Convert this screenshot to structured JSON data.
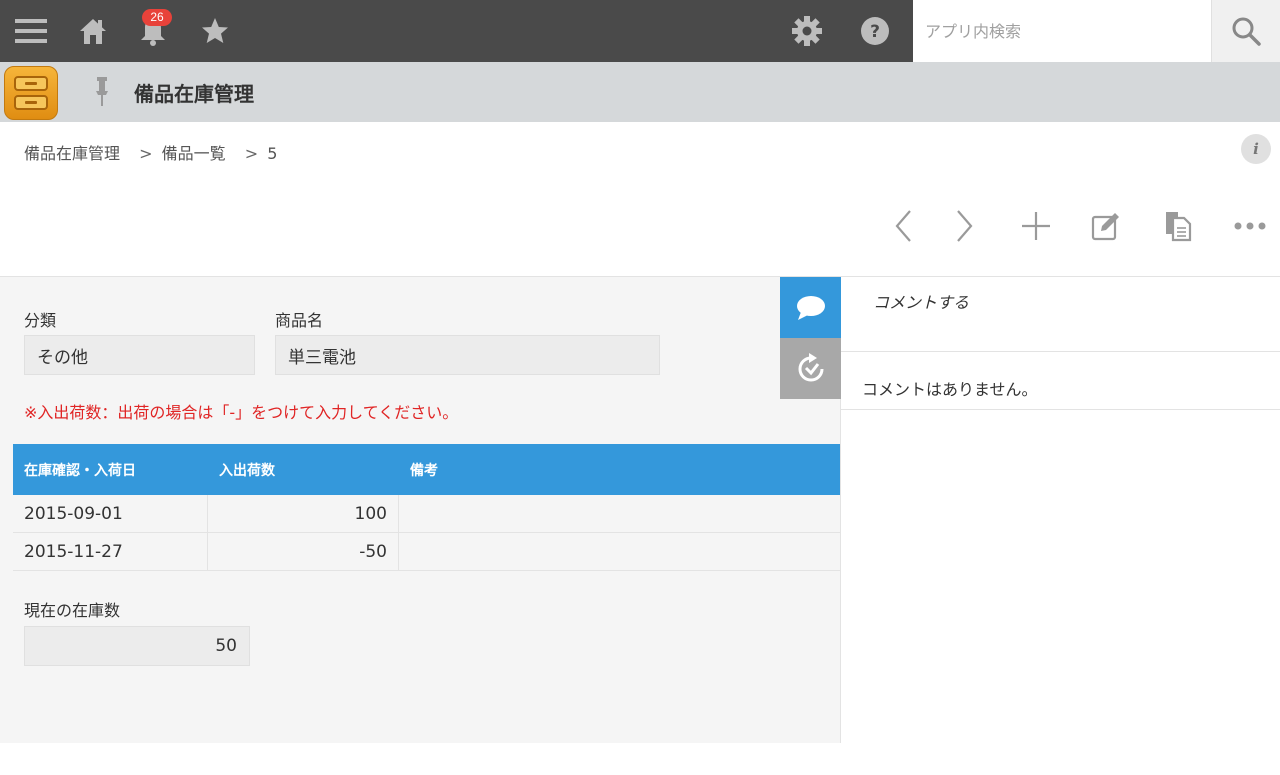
{
  "topbar": {
    "notification_count": "26",
    "search_placeholder": "アプリ内検索"
  },
  "app": {
    "title": "備品在庫管理"
  },
  "breadcrumb": {
    "items": [
      "備品在庫管理",
      "備品一覧",
      "5"
    ],
    "separator": ">"
  },
  "toolbar": {
    "icons": [
      "chevron-left-icon",
      "chevron-right-icon",
      "plus-icon",
      "edit-icon",
      "copy-icon",
      "more-icon"
    ]
  },
  "record": {
    "category_label": "分類",
    "category_value": "その他",
    "product_label": "商品名",
    "product_value": "単三電池",
    "notice": "※入出荷数：出荷の場合は「-」をつけて入力してください。",
    "table": {
      "headers": [
        "在庫確認・入荷日",
        "入出荷数",
        "備考"
      ],
      "rows": [
        [
          "2015-09-01",
          "100",
          ""
        ],
        [
          "2015-11-27",
          "-50",
          ""
        ]
      ]
    },
    "stock_label": "現在の在庫数",
    "stock_value": "50"
  },
  "comments": {
    "add_label": "コメントする",
    "empty_text": "コメントはありません。"
  },
  "colors": {
    "topbar": "#4a4a4a",
    "accent": "#3498db",
    "notice": "#e02525",
    "side_tab_active": "#3498db",
    "side_tab_inactive": "#a8a8a8"
  }
}
